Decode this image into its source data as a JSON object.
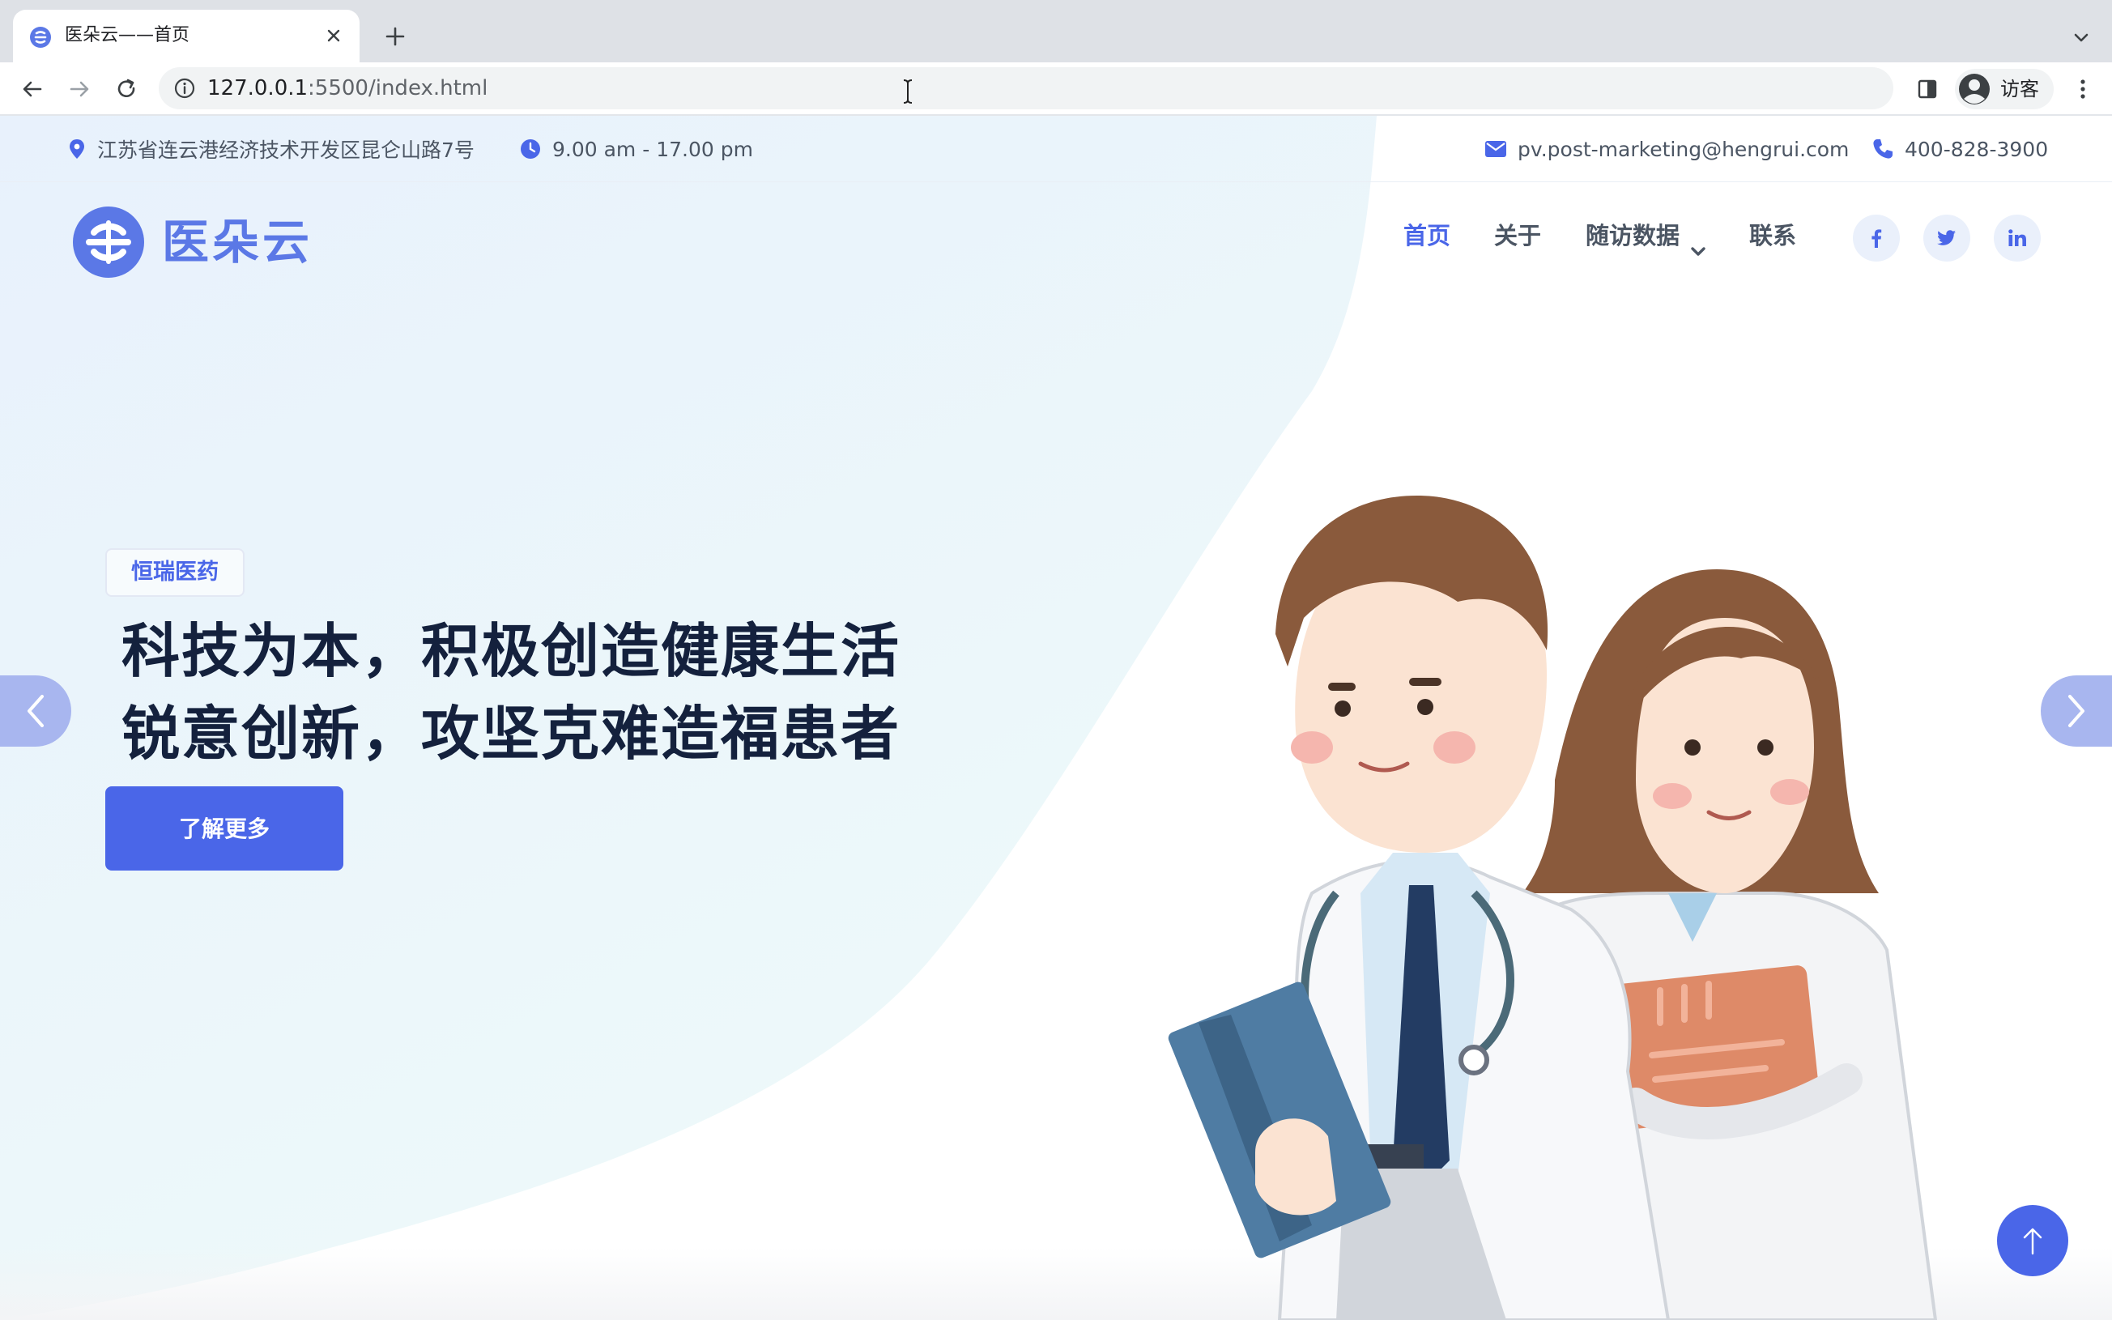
{
  "browser": {
    "tab_title": "医朵云——首页",
    "url_host": "127.0.0.1",
    "url_rest": ":5500/index.html",
    "profile_label": "访客"
  },
  "topbar": {
    "address": "江苏省连云港经济技术开发区昆仑山路7号",
    "hours": "9.00 am - 17.00 pm",
    "email": "pv.post-marketing@hengrui.com",
    "phone": "400-828-3900"
  },
  "brand": {
    "name": "医朵云"
  },
  "nav": {
    "items": [
      {
        "label": "首页",
        "active": true
      },
      {
        "label": "关于",
        "active": false
      },
      {
        "label": "随访数据",
        "active": false,
        "dropdown": true
      },
      {
        "label": "联系",
        "active": false
      }
    ]
  },
  "social": [
    "facebook-icon",
    "twitter-icon",
    "linkedin-icon"
  ],
  "hero": {
    "eyebrow": "恒瑞医药",
    "headline_line1": "科技为本，积极创造健康生活",
    "headline_line2": "锐意创新，攻坚克难造福患者",
    "cta_label": "了解更多"
  },
  "colors": {
    "accent": "#4a66e8",
    "heading": "#14213d",
    "body_text": "#4b5563",
    "hero_bg": "#eaf3fc"
  }
}
